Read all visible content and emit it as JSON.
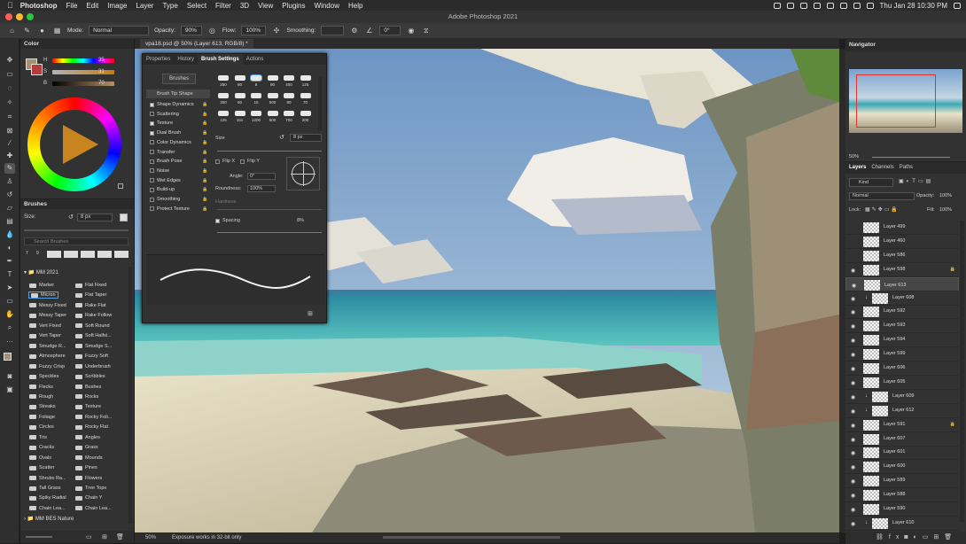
{
  "menubar": {
    "app": "Photoshop",
    "items": [
      "File",
      "Edit",
      "Image",
      "Layer",
      "Type",
      "Select",
      "Filter",
      "3D",
      "View",
      "Plugins",
      "Window",
      "Help"
    ],
    "clock": "Thu Jan 28  10:30 PM"
  },
  "window": {
    "title": "Adobe Photoshop 2021"
  },
  "options": {
    "mode_label": "Mode:",
    "mode_value": "Normal",
    "opacity_label": "Opacity:",
    "opacity_value": "90%",
    "flow_label": "Flow:",
    "flow_value": "100%",
    "smoothing_label": "Smoothing:",
    "angle_value": "0°"
  },
  "color_panel": {
    "title": "Color",
    "h_label": "H",
    "h_value": "35",
    "s_label": "S",
    "s_value": "31",
    "b_label": "B",
    "b_value": "70",
    "foreground": "#a89070",
    "background": "#b83a3a"
  },
  "brushes_panel": {
    "title": "Brushes",
    "size_label": "Size:",
    "size_value": "8 px",
    "search_placeholder": "Search Brushes",
    "group": "MM 2021",
    "group2": "MM BES Nature",
    "brushes_left": [
      "Marker",
      "Micron",
      "Messy Fixed",
      "Messy Taper",
      "Vert Fixed",
      "Vert Taper",
      "Smudge R...",
      "Atmosphere",
      "Fuzzy Crisp",
      "Speckles",
      "Flecks",
      "Rough",
      "Streaks",
      "Foliage",
      "Circles",
      "Tris",
      "Cracks",
      "Ovals",
      "Scatter",
      "Shrubs Ra...",
      "Tall Grass",
      "Spiky Radial",
      "Chain Lea..."
    ],
    "brushes_right": [
      "Flat Fixed",
      "Flat Taper",
      "Rake Flat",
      "Rake Follow",
      "Soft Round",
      "Soft Halfsi...",
      "Smudge S...",
      "Fuzzy Soft",
      "Underbrush",
      "Scribbles",
      "Bushes",
      "Rocks",
      "Texture",
      "Rocky Foli...",
      "Rocky Flat",
      "Angles",
      "Grass",
      "Mounds",
      "Pines",
      "Flowers",
      "Tree Tops",
      "Chain Y",
      "Chain Lea..."
    ],
    "tip_numbers": [
      "7",
      "9"
    ]
  },
  "document": {
    "tab": "vpa18.psd @ 50% (Layer 613, RGB/8) *",
    "zoom": "50%",
    "status": "Exposure works in 32-bit only"
  },
  "brush_settings": {
    "tabs": [
      "Properties",
      "History",
      "Brush Settings",
      "Actions"
    ],
    "brushes_button": "Brushes",
    "tip_shape": "Brush Tip Shape",
    "options": [
      {
        "label": "Shape Dynamics",
        "checked": true
      },
      {
        "label": "Scattering",
        "checked": false
      },
      {
        "label": "Texture",
        "checked": true
      },
      {
        "label": "Dual Brush",
        "checked": true
      },
      {
        "label": "Color Dynamics",
        "checked": false
      },
      {
        "label": "Transfer",
        "checked": false
      },
      {
        "label": "Brush Pose",
        "checked": false
      },
      {
        "label": "Noise",
        "checked": false
      },
      {
        "label": "Wet Edges",
        "checked": false
      },
      {
        "label": "Build-up",
        "checked": false
      },
      {
        "label": "Smoothing",
        "checked": false
      },
      {
        "label": "Protect Texture",
        "checked": false
      }
    ],
    "tip_sizes_row1": [
      "250",
      "80",
      "8",
      "90",
      "400",
      "125"
    ],
    "tip_sizes_row2": [
      "300",
      "60",
      "15",
      "500",
      "80",
      "70"
    ],
    "tip_sizes_row3": [
      "125",
      "151",
      "1200",
      "500",
      "700",
      "200"
    ],
    "size_label": "Size",
    "size_value": "8 px",
    "flipx": "Flip X",
    "flipy": "Flip Y",
    "angle_label": "Angle:",
    "angle_value": "0°",
    "roundness_label": "Roundness:",
    "roundness_value": "100%",
    "hardness_label": "Hardness",
    "spacing_label": "Spacing",
    "spacing_value": "8%"
  },
  "navigator": {
    "title": "Navigator",
    "zoom": "50%"
  },
  "layers": {
    "tabs": [
      "Layers",
      "Channels",
      "Paths"
    ],
    "kind": "Kind",
    "blend": "Normal",
    "opacity_label": "Opacity:",
    "opacity_value": "100%",
    "lock_label": "Lock:",
    "fill_label": "Fill:",
    "fill_value": "100%",
    "rows": [
      {
        "name": "Layer 499",
        "indent": false
      },
      {
        "name": "Layer 460",
        "indent": false
      },
      {
        "name": "Layer 586",
        "indent": false
      },
      {
        "name": "Layer 598",
        "indent": false,
        "locked": true
      },
      {
        "name": "Layer 613",
        "indent": false,
        "selected": true
      },
      {
        "name": "Layer 608",
        "indent": true
      },
      {
        "name": "Layer 592",
        "indent": false
      },
      {
        "name": "Layer 593",
        "indent": false
      },
      {
        "name": "Layer 594",
        "indent": false
      },
      {
        "name": "Layer 599",
        "indent": false
      },
      {
        "name": "Layer 606",
        "indent": false
      },
      {
        "name": "Layer 605",
        "indent": false
      },
      {
        "name": "Layer 609",
        "indent": true
      },
      {
        "name": "Layer 612",
        "indent": true
      },
      {
        "name": "Layer 591",
        "indent": false,
        "locked": true
      },
      {
        "name": "Layer 607",
        "indent": false
      },
      {
        "name": "Layer 601",
        "indent": false
      },
      {
        "name": "Layer 600",
        "indent": false
      },
      {
        "name": "Layer 589",
        "indent": false
      },
      {
        "name": "Layer 588",
        "indent": false
      },
      {
        "name": "Layer 590",
        "indent": false
      },
      {
        "name": "Layer 610",
        "indent": true
      }
    ]
  }
}
